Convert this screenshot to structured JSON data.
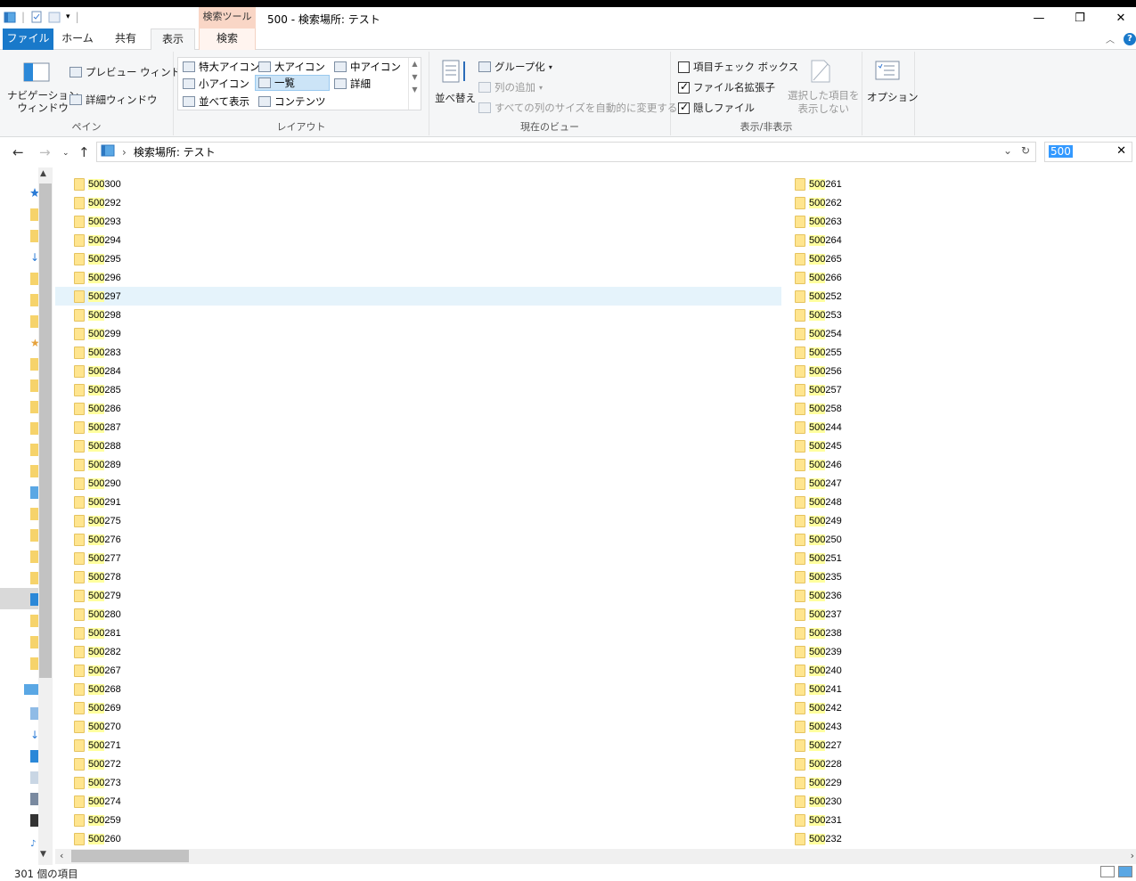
{
  "window": {
    "title": "500 - 検索場所: テスト",
    "context_tab_group": "検索ツール"
  },
  "tabs": [
    {
      "label": "ファイル"
    },
    {
      "label": "ホーム"
    },
    {
      "label": "共有"
    },
    {
      "label": "表示"
    },
    {
      "label": "検索"
    }
  ],
  "ribbon": {
    "pane": {
      "label": "ペイン",
      "nav_pane": "ナビゲーション\nウィンドウ",
      "preview": "プレビュー ウィンドウ",
      "details": "詳細ウィンドウ"
    },
    "layout": {
      "label": "レイアウト",
      "items": [
        "特大アイコン",
        "大アイコン",
        "中アイコン",
        "小アイコン",
        "一覧",
        "詳細",
        "並べて表示",
        "コンテンツ"
      ],
      "selected": "一覧"
    },
    "current_view": {
      "label": "現在のビュー",
      "sort": "並べ替え",
      "group": "グループ化",
      "add_column": "列の追加",
      "fit_columns": "すべての列のサイズを自動的に変更する"
    },
    "show_hide": {
      "label": "表示/非表示",
      "item_checkboxes": {
        "label": "項目チェック ボックス",
        "checked": false
      },
      "extensions": {
        "label": "ファイル名拡張子",
        "checked": true
      },
      "hidden": {
        "label": "隠しファイル",
        "checked": true
      },
      "hide_selected": "選択した項目を\n表示しない"
    },
    "options": "オプション"
  },
  "address": {
    "path": "検索場所: テスト",
    "search_value": "500"
  },
  "search_highlight": "500",
  "items_col1": [
    "300",
    "292",
    "293",
    "294",
    "295",
    "296",
    "297",
    "298",
    "299",
    "283",
    "284",
    "285",
    "286",
    "287",
    "288",
    "289",
    "290",
    "291",
    "275",
    "276",
    "277",
    "278",
    "279",
    "280",
    "281",
    "282",
    "267",
    "268",
    "269",
    "270",
    "271",
    "272",
    "273",
    "274",
    "259",
    "260"
  ],
  "items_col2": [
    "261",
    "262",
    "263",
    "264",
    "265",
    "266",
    "252",
    "253",
    "254",
    "255",
    "256",
    "257",
    "258",
    "244",
    "245",
    "246",
    "247",
    "248",
    "249",
    "250",
    "251",
    "235",
    "236",
    "237",
    "238",
    "239",
    "240",
    "241",
    "242",
    "243",
    "227",
    "228",
    "229",
    "230",
    "231",
    "232"
  ],
  "hover_item": "500297",
  "status": {
    "count": "301 個の項目"
  }
}
